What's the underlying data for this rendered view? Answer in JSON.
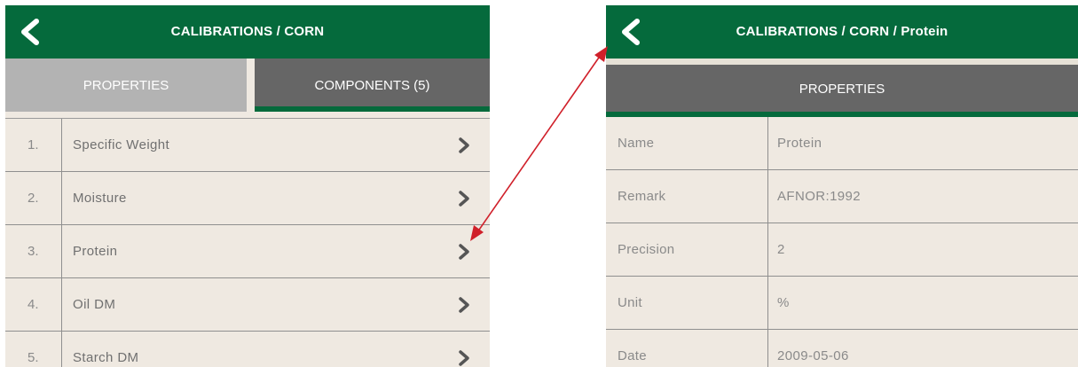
{
  "left_screen": {
    "header": {
      "title": "CALIBRATIONS / CORN",
      "back_icon": "chevron-left-icon"
    },
    "tabs": [
      {
        "label": "PROPERTIES",
        "active": false
      },
      {
        "label": "COMPONENTS (5)",
        "active": true
      }
    ],
    "components": [
      {
        "index": "1.",
        "name": "Specific Weight"
      },
      {
        "index": "2.",
        "name": "Moisture"
      },
      {
        "index": "3.",
        "name": "Protein"
      },
      {
        "index": "4.",
        "name": "Oil DM"
      },
      {
        "index": "5.",
        "name": "Starch DM"
      }
    ]
  },
  "right_screen": {
    "header": {
      "title": "CALIBRATIONS / CORN / Protein",
      "back_icon": "chevron-left-icon"
    },
    "section_title": "PROPERTIES",
    "properties": [
      {
        "key": "Name",
        "value": "Protein"
      },
      {
        "key": "Remark",
        "value": "AFNOR:1992"
      },
      {
        "key": "Precision",
        "value": "2"
      },
      {
        "key": "Unit",
        "value": "%"
      },
      {
        "key": "Date",
        "value": "2009-05-06"
      }
    ]
  },
  "colors": {
    "brand_green": "#056a3c",
    "tab_inactive": "#b3b3b3",
    "tab_active": "#666666",
    "background": "#efe9e1",
    "annotation_arrow": "#d0202a"
  }
}
